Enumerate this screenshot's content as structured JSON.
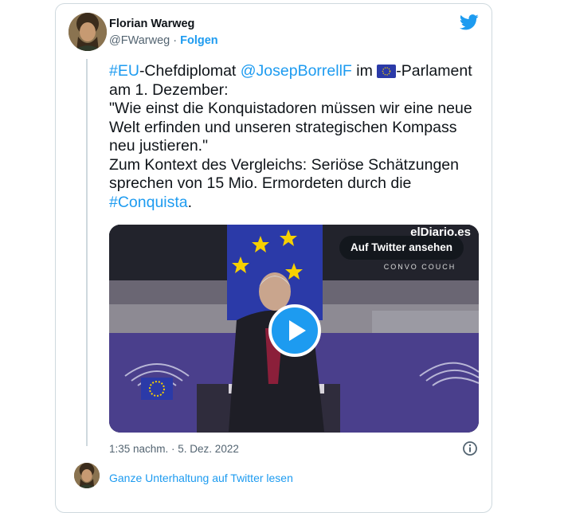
{
  "author": {
    "name": "Florian Warweg",
    "handle": "@FWarweg",
    "separator": "·",
    "follow_label": "Folgen"
  },
  "tweet": {
    "lines": [
      {
        "parts": [
          {
            "text": "#EU",
            "link": true
          },
          {
            "text": "-Chefdiplomat ",
            "link": false
          },
          {
            "text": "@JosepBorrellF",
            "link": true
          },
          {
            "text": " im ",
            "link": false
          },
          {
            "flag": "eu-flag-icon"
          },
          {
            "text": "-Parlament",
            "link": false
          }
        ]
      },
      {
        "parts": [
          {
            "text": "am 1. Dezember:",
            "link": false
          }
        ]
      },
      {
        "parts": [
          {
            "text": "\"Wie einst die Konquistadoren müssen wir eine neue",
            "link": false
          }
        ]
      },
      {
        "parts": [
          {
            "text": "Welt erfinden und unseren strategischen Kompass",
            "link": false
          }
        ]
      },
      {
        "parts": [
          {
            "text": "neu justieren.\"",
            "link": false
          }
        ]
      },
      {
        "parts": [
          {
            "text": "Zum Kontext des Vergleichs: Seriöse Schätzungen",
            "link": false
          }
        ]
      },
      {
        "parts": [
          {
            "text": "sprechen von 15 Mio. Ermordeten durch die",
            "link": false
          }
        ]
      },
      {
        "parts": [
          {
            "text": "#Conquista",
            "link": true
          },
          {
            "text": ".",
            "link": false
          }
        ]
      }
    ]
  },
  "video": {
    "watch_label": "Auf Twitter ansehen",
    "watermark": "elDiario.es",
    "banner_text": "CONVO COUCH"
  },
  "meta": {
    "timestamp": "1:35 nachm. · 5. Dez. 2022"
  },
  "footer": {
    "read_more_label": "Ganze Unterhaltung auf Twitter lesen"
  },
  "colors": {
    "link": "#1d9bf0",
    "text": "#0f1419",
    "muted": "#536471",
    "border": "#cfd9de"
  }
}
